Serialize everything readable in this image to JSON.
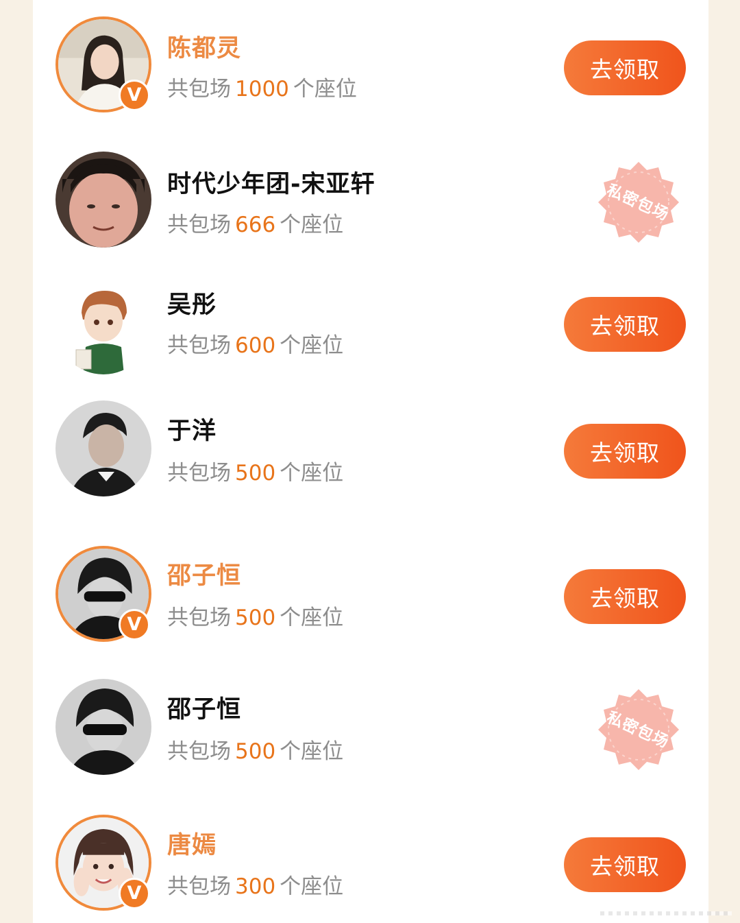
{
  "colors": {
    "background": "#f8f1e5",
    "card": "#ffffff",
    "accent": "#f0541c",
    "vip_name": "#ec8a43",
    "seat_number": "#e8741a",
    "seat_text": "#8d8d8d"
  },
  "list": {
    "seat_prefix": "共包场",
    "seat_suffix": "个座位",
    "claim_label": "去领取",
    "private_label": "私密包场",
    "items": [
      {
        "name": "陈都灵",
        "seats": "1000",
        "verified": true,
        "action": "claim"
      },
      {
        "name": "时代少年团-宋亚轩",
        "seats": "666",
        "verified": false,
        "action": "private"
      },
      {
        "name": "吴彤",
        "seats": "600",
        "verified": false,
        "action": "claim"
      },
      {
        "name": "于洋",
        "seats": "500",
        "verified": false,
        "action": "claim"
      },
      {
        "name": "邵子恒",
        "seats": "500",
        "verified": true,
        "action": "claim"
      },
      {
        "name": "邵子恒",
        "seats": "500",
        "verified": false,
        "action": "private"
      },
      {
        "name": "唐嫣",
        "seats": "300",
        "verified": true,
        "action": "claim"
      }
    ]
  },
  "icons": {
    "verified_badge": "V",
    "avatar": "user-avatar-icon",
    "stamp": "private-stamp-icon"
  }
}
